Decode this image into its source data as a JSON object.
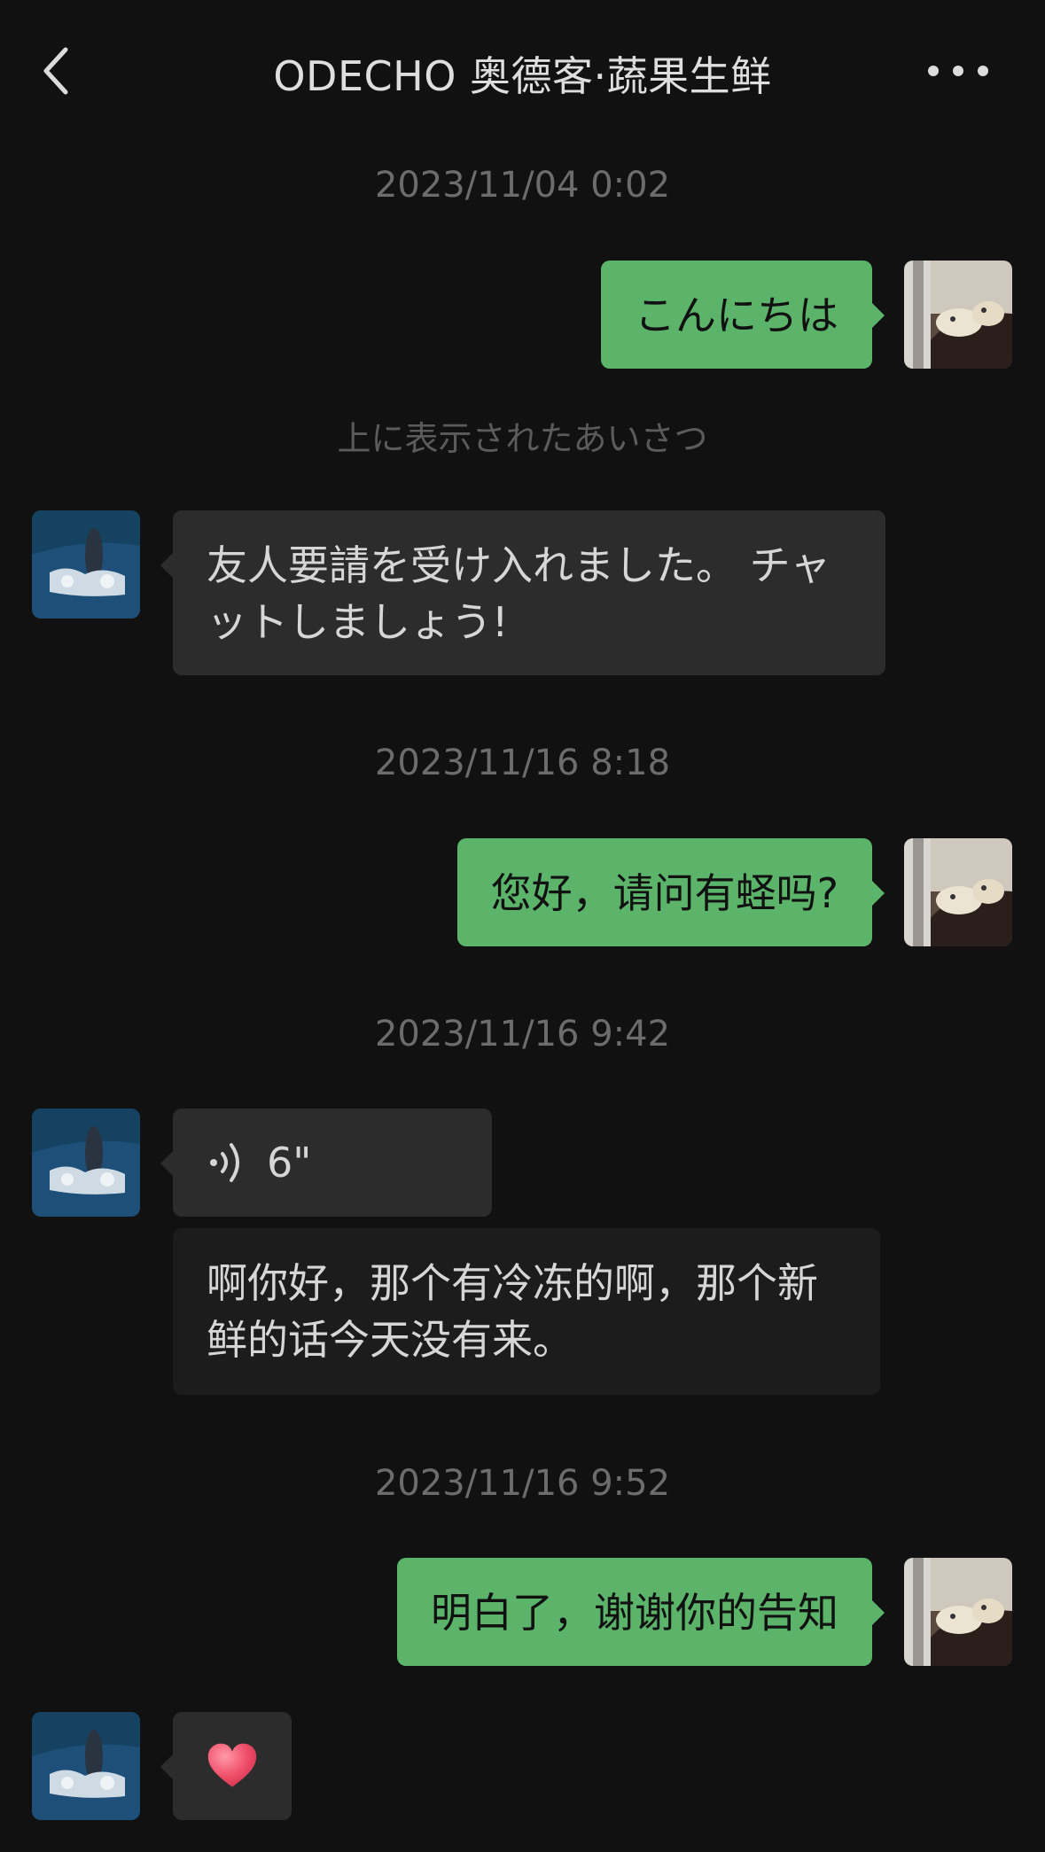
{
  "header": {
    "title": "ODECHO 奥德客·蔬果生鲜",
    "back_icon": "chevron-left-icon",
    "more_icon": "more-dots-icon"
  },
  "colors": {
    "background": "#111111",
    "outgoing_bubble": "#5cb46b",
    "incoming_bubble": "#2c2c2c",
    "transcript_bubble": "#1c1c1c"
  },
  "messages": {
    "ts1": "2023/11/04 0:02",
    "m1": "こんにちは",
    "note1": "上に表示されたあいさつ",
    "m2_line1": "友人要請を受け入れました。 チャ",
    "m2_line2": "ットしましょう!",
    "ts2": "2023/11/16 8:18",
    "m3": "您好，请问有蛏吗?",
    "ts3": "2023/11/16 9:42",
    "m4_voice_duration": "6\"",
    "m4_transcript_line1": "啊你好，那个有冷冻的啊，那个新",
    "m4_transcript_line2": "鲜的话今天没有来。",
    "ts4": "2023/11/16 9:52",
    "m5": "明白了，谢谢你的告知",
    "m6_sticker": "heart-icon"
  }
}
